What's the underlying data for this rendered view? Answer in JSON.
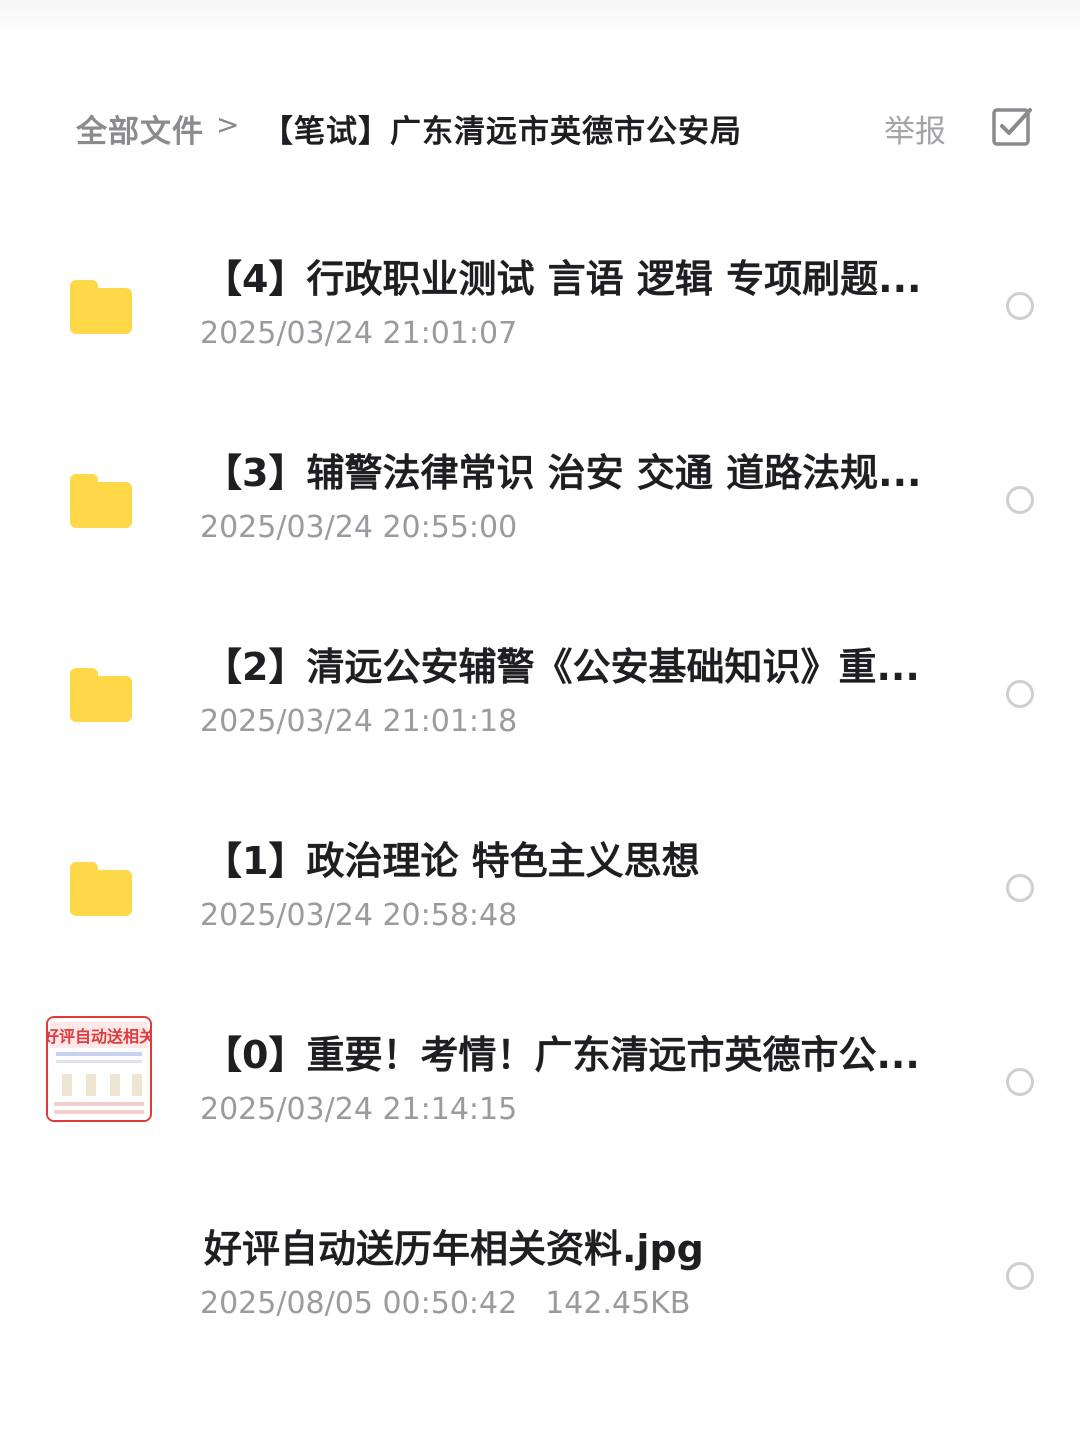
{
  "breadcrumb": {
    "root": "全部文件",
    "separator": ">",
    "current": "【笔试】广东清远市英德市公安局"
  },
  "header": {
    "report_label": "举报",
    "select_icon": "checkbox-icon"
  },
  "files": [
    {
      "type": "folder",
      "name": "【4】行政职业测试 言语 逻辑 专项刷题...",
      "date": "2025/03/24 21:01:07"
    },
    {
      "type": "folder",
      "name": "【3】辅警法律常识 治安 交通 道路法规...",
      "date": "2025/03/24 20:55:00"
    },
    {
      "type": "folder",
      "name": "【2】清远公安辅警《公安基础知识》重...",
      "date": "2025/03/24 21:01:18"
    },
    {
      "type": "folder",
      "name": "【1】政治理论 特色主义思想",
      "date": "2025/03/24 20:58:48"
    },
    {
      "type": "folder",
      "name": "【0】重要！考情！广东清远市英德市公...",
      "date": "2025/03/24 21:14:15"
    },
    {
      "type": "image",
      "name": "好评自动送历年相关资料.jpg",
      "date": "2025/08/05 00:50:42",
      "size": "142.45KB",
      "thumb_text": "好评自动送相关"
    }
  ],
  "colors": {
    "folder": "#ffd84a",
    "title": "#1f1f23",
    "secondary": "#9a9aa0",
    "thumb_accent": "#e23a3a"
  }
}
